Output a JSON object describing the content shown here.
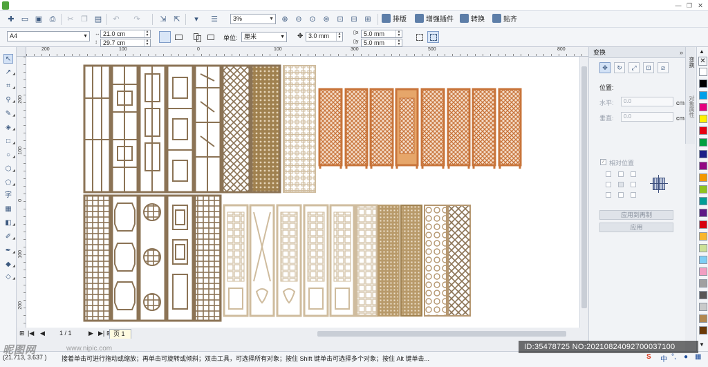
{
  "window": {
    "min_symbol": "—",
    "restore_symbol": "❐",
    "close_symbol": "✕"
  },
  "toolbar": {
    "zoom": "3%",
    "arrange": "排版",
    "enhance_plugin": "增强插件",
    "convert": "转换",
    "paste": "贴齐"
  },
  "property_bar": {
    "page_size": "A4",
    "width": "21.0 cm",
    "height": "29.7 cm",
    "unit_label": "单位:",
    "unit_value": "厘米",
    "nudge": "3.0 mm",
    "dup_x": "5.0 mm",
    "dup_y": "5.0 mm"
  },
  "rulers": {
    "h_ticks": [
      "200",
      "100",
      "0",
      "100",
      "200",
      "300",
      "400",
      "500",
      "600",
      "700",
      "800"
    ],
    "v_ticks": [
      "200",
      "100",
      "0",
      "100",
      "200"
    ]
  },
  "page_nav": {
    "page_count": "1 / 1",
    "tab_label": "页 1"
  },
  "docker": {
    "title": "变换",
    "position_label": "位置:",
    "h_label": "水平:",
    "h_value": "0.0",
    "v_label": "垂直:",
    "v_value": "0.0",
    "unit": "cm",
    "relative_label": "相对位置",
    "apply_copy": "应用到再制",
    "apply": "应用"
  },
  "docker_tabs": [
    "变换",
    "对象属性"
  ],
  "palette": [
    "#ffffff",
    "#000000",
    "#00a0e9",
    "#e5007f",
    "#fff100",
    "#e60012",
    "#00a040",
    "#1d2088",
    "#920783",
    "#f39800",
    "#8fc31f",
    "#009e96",
    "#601986",
    "#d7000f",
    "#f8b62d",
    "#cce198",
    "#7ecef4",
    "#f19ec2",
    "#a0a0a0",
    "#595757",
    "#c9caca",
    "#b28850",
    "#6a3906"
  ],
  "status": {
    "coords": "(21.713, 3.637 )",
    "hint": "接着单击可进行拖动或缩放；再单击可旋转或倾斜；双击工具，可选择所有对象；按住 Shift 键单击可选择多个对象；按住 Alt 键单击..."
  },
  "watermark": {
    "brand": "昵图网",
    "url": "www.nipic.com",
    "id_text": "ID:35478725 NO:20210824092700037100"
  },
  "ime": {
    "mode": "中",
    "punct": "°,",
    "mic": "🎤"
  },
  "panel_colors": {
    "brown": "#8b7355",
    "tan": "#a0814f",
    "red_orange": "#c8743a",
    "light_tan": "#cfbc9e",
    "light_grey": "#d8d3c8"
  }
}
